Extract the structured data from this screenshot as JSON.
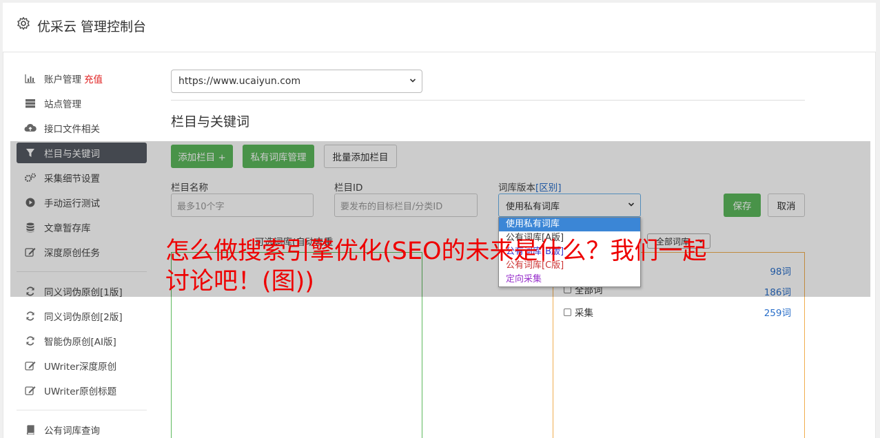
{
  "header": {
    "title": "优采云 管理控制台",
    "icon": "gear-icon"
  },
  "sidebar": {
    "items": [
      {
        "label": "账户管理",
        "badge": "充值",
        "icon": "bar-chart-icon"
      },
      {
        "label": "站点管理",
        "icon": "server-icon"
      },
      {
        "label": "接口文件相关",
        "icon": "cloud-upload-icon"
      },
      {
        "label": "栏目与关键词",
        "icon": "filter-icon",
        "active": true
      },
      {
        "label": "采集细节设置",
        "icon": "gears-icon"
      },
      {
        "label": "手动运行测试",
        "icon": "play-circle-icon"
      },
      {
        "label": "文章暂存库",
        "icon": "database-icon"
      },
      {
        "label": "深度原创任务",
        "icon": "edit-icon"
      },
      {
        "label": "同义词伪原创[1版]",
        "icon": "refresh-icon"
      },
      {
        "label": "同义词伪原创[2版]",
        "icon": "refresh-icon"
      },
      {
        "label": "智能伪原创[AI版]",
        "icon": "refresh-icon"
      },
      {
        "label": "UWriter深度原创",
        "icon": "edit-icon"
      },
      {
        "label": "UWriter原创标题",
        "icon": "edit-icon"
      },
      {
        "label": "公有词库查询",
        "icon": "book-icon"
      }
    ]
  },
  "site_select": {
    "value": "https://www.ucaiyun.com"
  },
  "section": {
    "title": "栏目与关键词"
  },
  "toolbar": {
    "add_column": "添加栏目 +",
    "private_lib": "私有词库管理",
    "batch_add": "批量添加栏目"
  },
  "form": {
    "column_name_label": "栏目名称",
    "column_name_placeholder": "最多10个字",
    "column_id_label": "栏目ID",
    "column_id_placeholder": "要发布的目标栏目/分类ID",
    "lib_version_label": "词库版本",
    "lib_version_link": "[区别]",
    "lib_version_value": "使用私有词库",
    "save": "保存",
    "cancel": "取消"
  },
  "dropdown": {
    "options": [
      {
        "label": "使用私有词库",
        "color": "#ffffff",
        "selected": true
      },
      {
        "label": "公有词库[A版]",
        "color": "#333333"
      },
      {
        "label": "公有词库[B版]",
        "color": "#3333cc"
      },
      {
        "label": "公有词库[C版]",
        "color": "#cc3333"
      },
      {
        "label": "定向采集",
        "color": "#9933cc"
      }
    ]
  },
  "panels": {
    "left_title": "可选词库(自动去重",
    "filter_value": "全部词库",
    "rows": [
      {
        "label": "",
        "count": "98词"
      },
      {
        "label": "全部词",
        "count": "186词"
      },
      {
        "label": "采集",
        "count": "259词"
      }
    ]
  },
  "headline": "怎么做搜索引擎优化(SEO的未来是什么？我们一起讨论吧！(图))",
  "colors": {
    "accent_green": "#5cb85c",
    "link_blue": "#2a6fc9",
    "headline_red": "#ee0000",
    "active_nav": "#555b63"
  }
}
